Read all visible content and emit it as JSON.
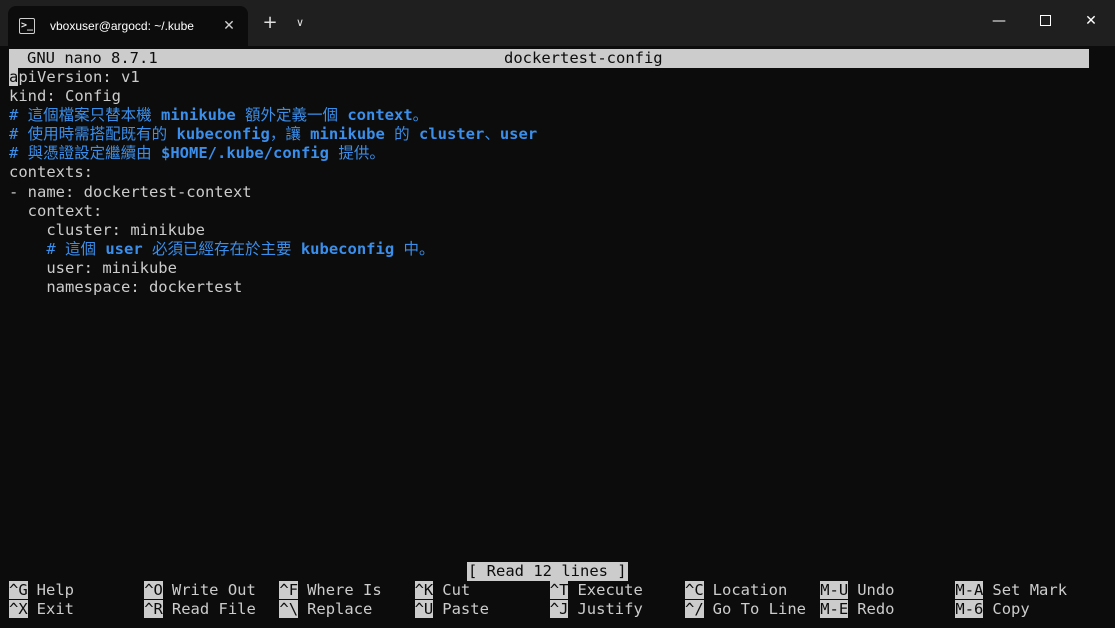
{
  "window": {
    "tab_title": "vboxuser@argocd: ~/.kube",
    "tab_icon_glyph": ">_",
    "close_glyph": "✕",
    "new_tab_glyph": "+",
    "dropdown_glyph": "∨",
    "minimize_glyph": "—",
    "close_window_glyph": "✕"
  },
  "nano": {
    "version": "GNU nano 8.7.1",
    "filename": "dockertest-config",
    "status": "[ Read 12 lines ]"
  },
  "file_lines": [
    {
      "text": "apiVersion: v1",
      "type": "code"
    },
    {
      "text": "kind: Config",
      "type": "code"
    },
    {
      "text": "# 這個檔案只替本機 minikube 額外定義一個 context。",
      "type": "comment"
    },
    {
      "text": "# 使用時需搭配既有的 kubeconfig，讓 minikube 的 cluster、user",
      "type": "comment"
    },
    {
      "text": "# 與憑證設定繼續由 $HOME/.kube/config 提供。",
      "type": "comment"
    },
    {
      "text": "contexts:",
      "type": "code"
    },
    {
      "text": "- name: dockertest-context",
      "type": "code"
    },
    {
      "text": "  context:",
      "type": "code"
    },
    {
      "text": "    cluster: minikube",
      "type": "code"
    },
    {
      "text": "    # 這個 user 必須已經存在於主要 kubeconfig 中。",
      "type": "comment"
    },
    {
      "text": "    user: minikube",
      "type": "code"
    },
    {
      "text": "    namespace: dockertest",
      "type": "code"
    }
  ],
  "shortcuts": [
    {
      "key": "^G",
      "label": "Help"
    },
    {
      "key": "^O",
      "label": "Write Out"
    },
    {
      "key": "^F",
      "label": "Where Is"
    },
    {
      "key": "^K",
      "label": "Cut"
    },
    {
      "key": "^T",
      "label": "Execute"
    },
    {
      "key": "^C",
      "label": "Location"
    },
    {
      "key": "M-U",
      "label": "Undo"
    },
    {
      "key": "M-A",
      "label": "Set Mark"
    },
    {
      "key": "^X",
      "label": "Exit"
    },
    {
      "key": "^R",
      "label": "Read File"
    },
    {
      "key": "^\\",
      "label": "Replace"
    },
    {
      "key": "^U",
      "label": "Paste"
    },
    {
      "key": "^J",
      "label": "Justify"
    },
    {
      "key": "^/",
      "label": "Go To Line"
    },
    {
      "key": "M-E",
      "label": "Redo"
    },
    {
      "key": "M-6",
      "label": "Copy"
    }
  ],
  "colors": {
    "background": "#0c0c0c",
    "foreground": "#cccccc",
    "comment": "#3b8eea",
    "titlebar": "#1f1f1f"
  }
}
